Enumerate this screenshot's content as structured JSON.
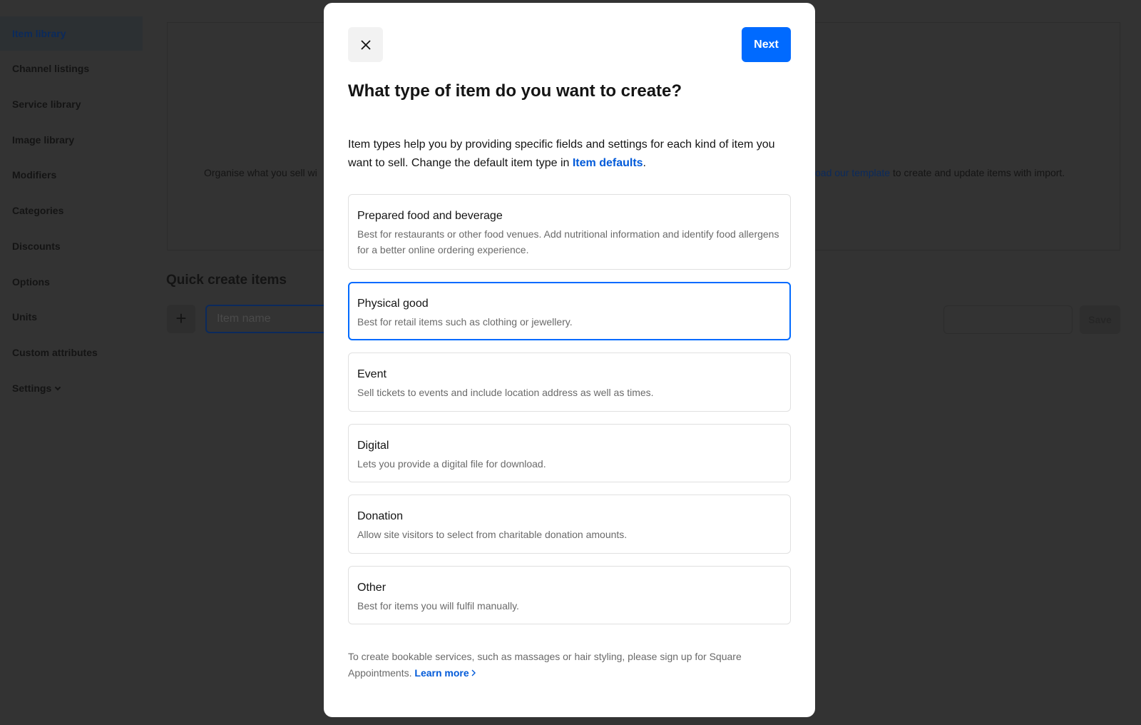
{
  "sidebar": {
    "items": [
      {
        "label": "Item library",
        "active": true
      },
      {
        "label": "Channel listings"
      },
      {
        "label": "Service library"
      },
      {
        "label": "Image library"
      },
      {
        "label": "Modifiers"
      },
      {
        "label": "Categories"
      },
      {
        "label": "Discounts"
      },
      {
        "label": "Options"
      },
      {
        "label": "Units"
      },
      {
        "label": "Custom attributes"
      },
      {
        "label": "Settings"
      }
    ]
  },
  "background": {
    "organise_left": "Organise what you sell wi",
    "organise_link": "oad our template",
    "organise_right": " to create and update items with import.",
    "quick_create_title": "Quick create items",
    "item_name_placeholder": "Item name",
    "save_label": "Save"
  },
  "modal": {
    "next_label": "Next",
    "title": "What type of item do you want to create?",
    "description": "Item types help you by providing specific fields and settings for each kind of item you want to sell. Change the default item type in ",
    "description_link": "Item defaults",
    "description_end": ".",
    "options": [
      {
        "title": "Prepared food and beverage",
        "desc": "Best for restaurants or other food venues. Add nutritional information and identify food allergens for a better online ordering experience."
      },
      {
        "title": "Physical good",
        "desc": "Best for retail items such as clothing or jewellery.",
        "selected": true
      },
      {
        "title": "Event",
        "desc": "Sell tickets to events and include location address as well as times."
      },
      {
        "title": "Digital",
        "desc": "Lets you provide a digital file for download."
      },
      {
        "title": "Donation",
        "desc": "Allow site visitors to select from charitable donation amounts."
      },
      {
        "title": "Other",
        "desc": "Best for items you will fulfil manually."
      }
    ],
    "footer_text": "To create bookable services, such as massages or hair styling, please sign up for Square Appointments. ",
    "footer_link": "Learn more",
    "footer_link_icon": "chevron-right-icon"
  },
  "colors": {
    "accent": "#006aff",
    "link": "#005ad9",
    "overlay": "#333333"
  }
}
